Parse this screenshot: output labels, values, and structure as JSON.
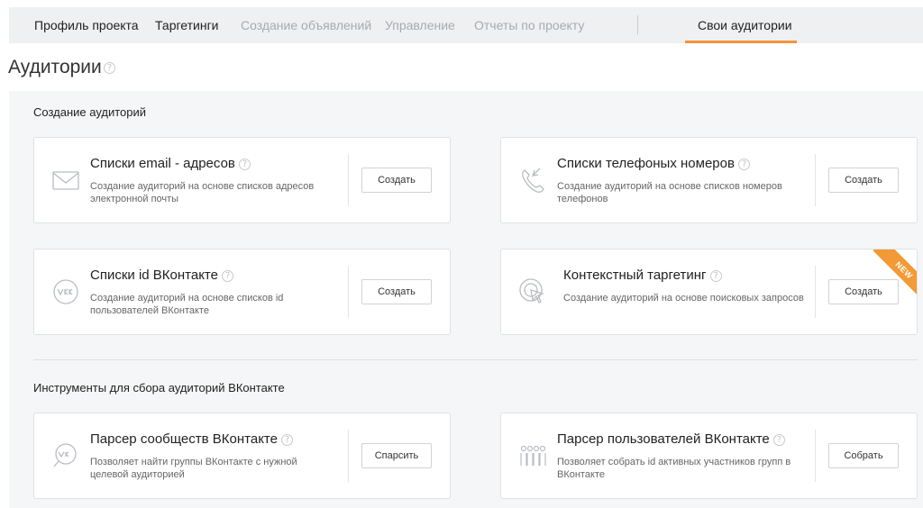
{
  "nav": {
    "items": [
      {
        "label": "Профиль проекта",
        "state": "active"
      },
      {
        "label": "Таргетинги",
        "state": "active"
      },
      {
        "label": "Создание объявлений",
        "state": "disabled"
      },
      {
        "label": "Управление",
        "state": "disabled"
      },
      {
        "label": "Отчеты по проекту",
        "state": "disabled"
      }
    ],
    "current": "Свои аудитории"
  },
  "page": {
    "title": "Аудитории",
    "help": "?"
  },
  "sections": {
    "create": {
      "title": "Создание аудиторий"
    },
    "tools": {
      "title": "Инструменты для сбора аудиторий ВКонтакте"
    }
  },
  "cards": {
    "email": {
      "title": "Списки email - адресов",
      "desc": "Создание аудиторий на основе списков адресов электронной почты",
      "button": "Создать",
      "icon": "envelope-icon"
    },
    "phone": {
      "title": "Списки телефоных номеров",
      "desc": "Создание аудиторий на основе списков номеров телефонов",
      "button": "Создать",
      "icon": "phone-icon"
    },
    "vkid": {
      "title": "Списки id ВКонтакте",
      "desc": "Создание аудиторий на основе списков id пользователей ВКонтакте",
      "button": "Создать",
      "icon": "vk-icon"
    },
    "context": {
      "title": "Контекстный таргетинг",
      "desc": "Создание аудиторий на основе поисковых запросов",
      "button": "Создать",
      "icon": "target-cursor-icon",
      "badge": "NEW"
    },
    "groups_parser": {
      "title": "Парсер сообществ ВКонтакте",
      "desc": "Позволяет найти группы ВКонтакте с нужной целевой аудиторией",
      "button": "Спарсить",
      "icon": "vk-search-icon"
    },
    "users_parser": {
      "title": "Парсер пользователей ВКонтакте",
      "desc": "Позволяет собрать id активных участников групп в ВКонтакте",
      "button": "Собрать",
      "icon": "users-icon"
    }
  },
  "colors": {
    "accent": "#f7923a",
    "badge": "#f29a35",
    "nav_bg": "#eef0f2",
    "panel_bg": "#f5f6f7"
  }
}
